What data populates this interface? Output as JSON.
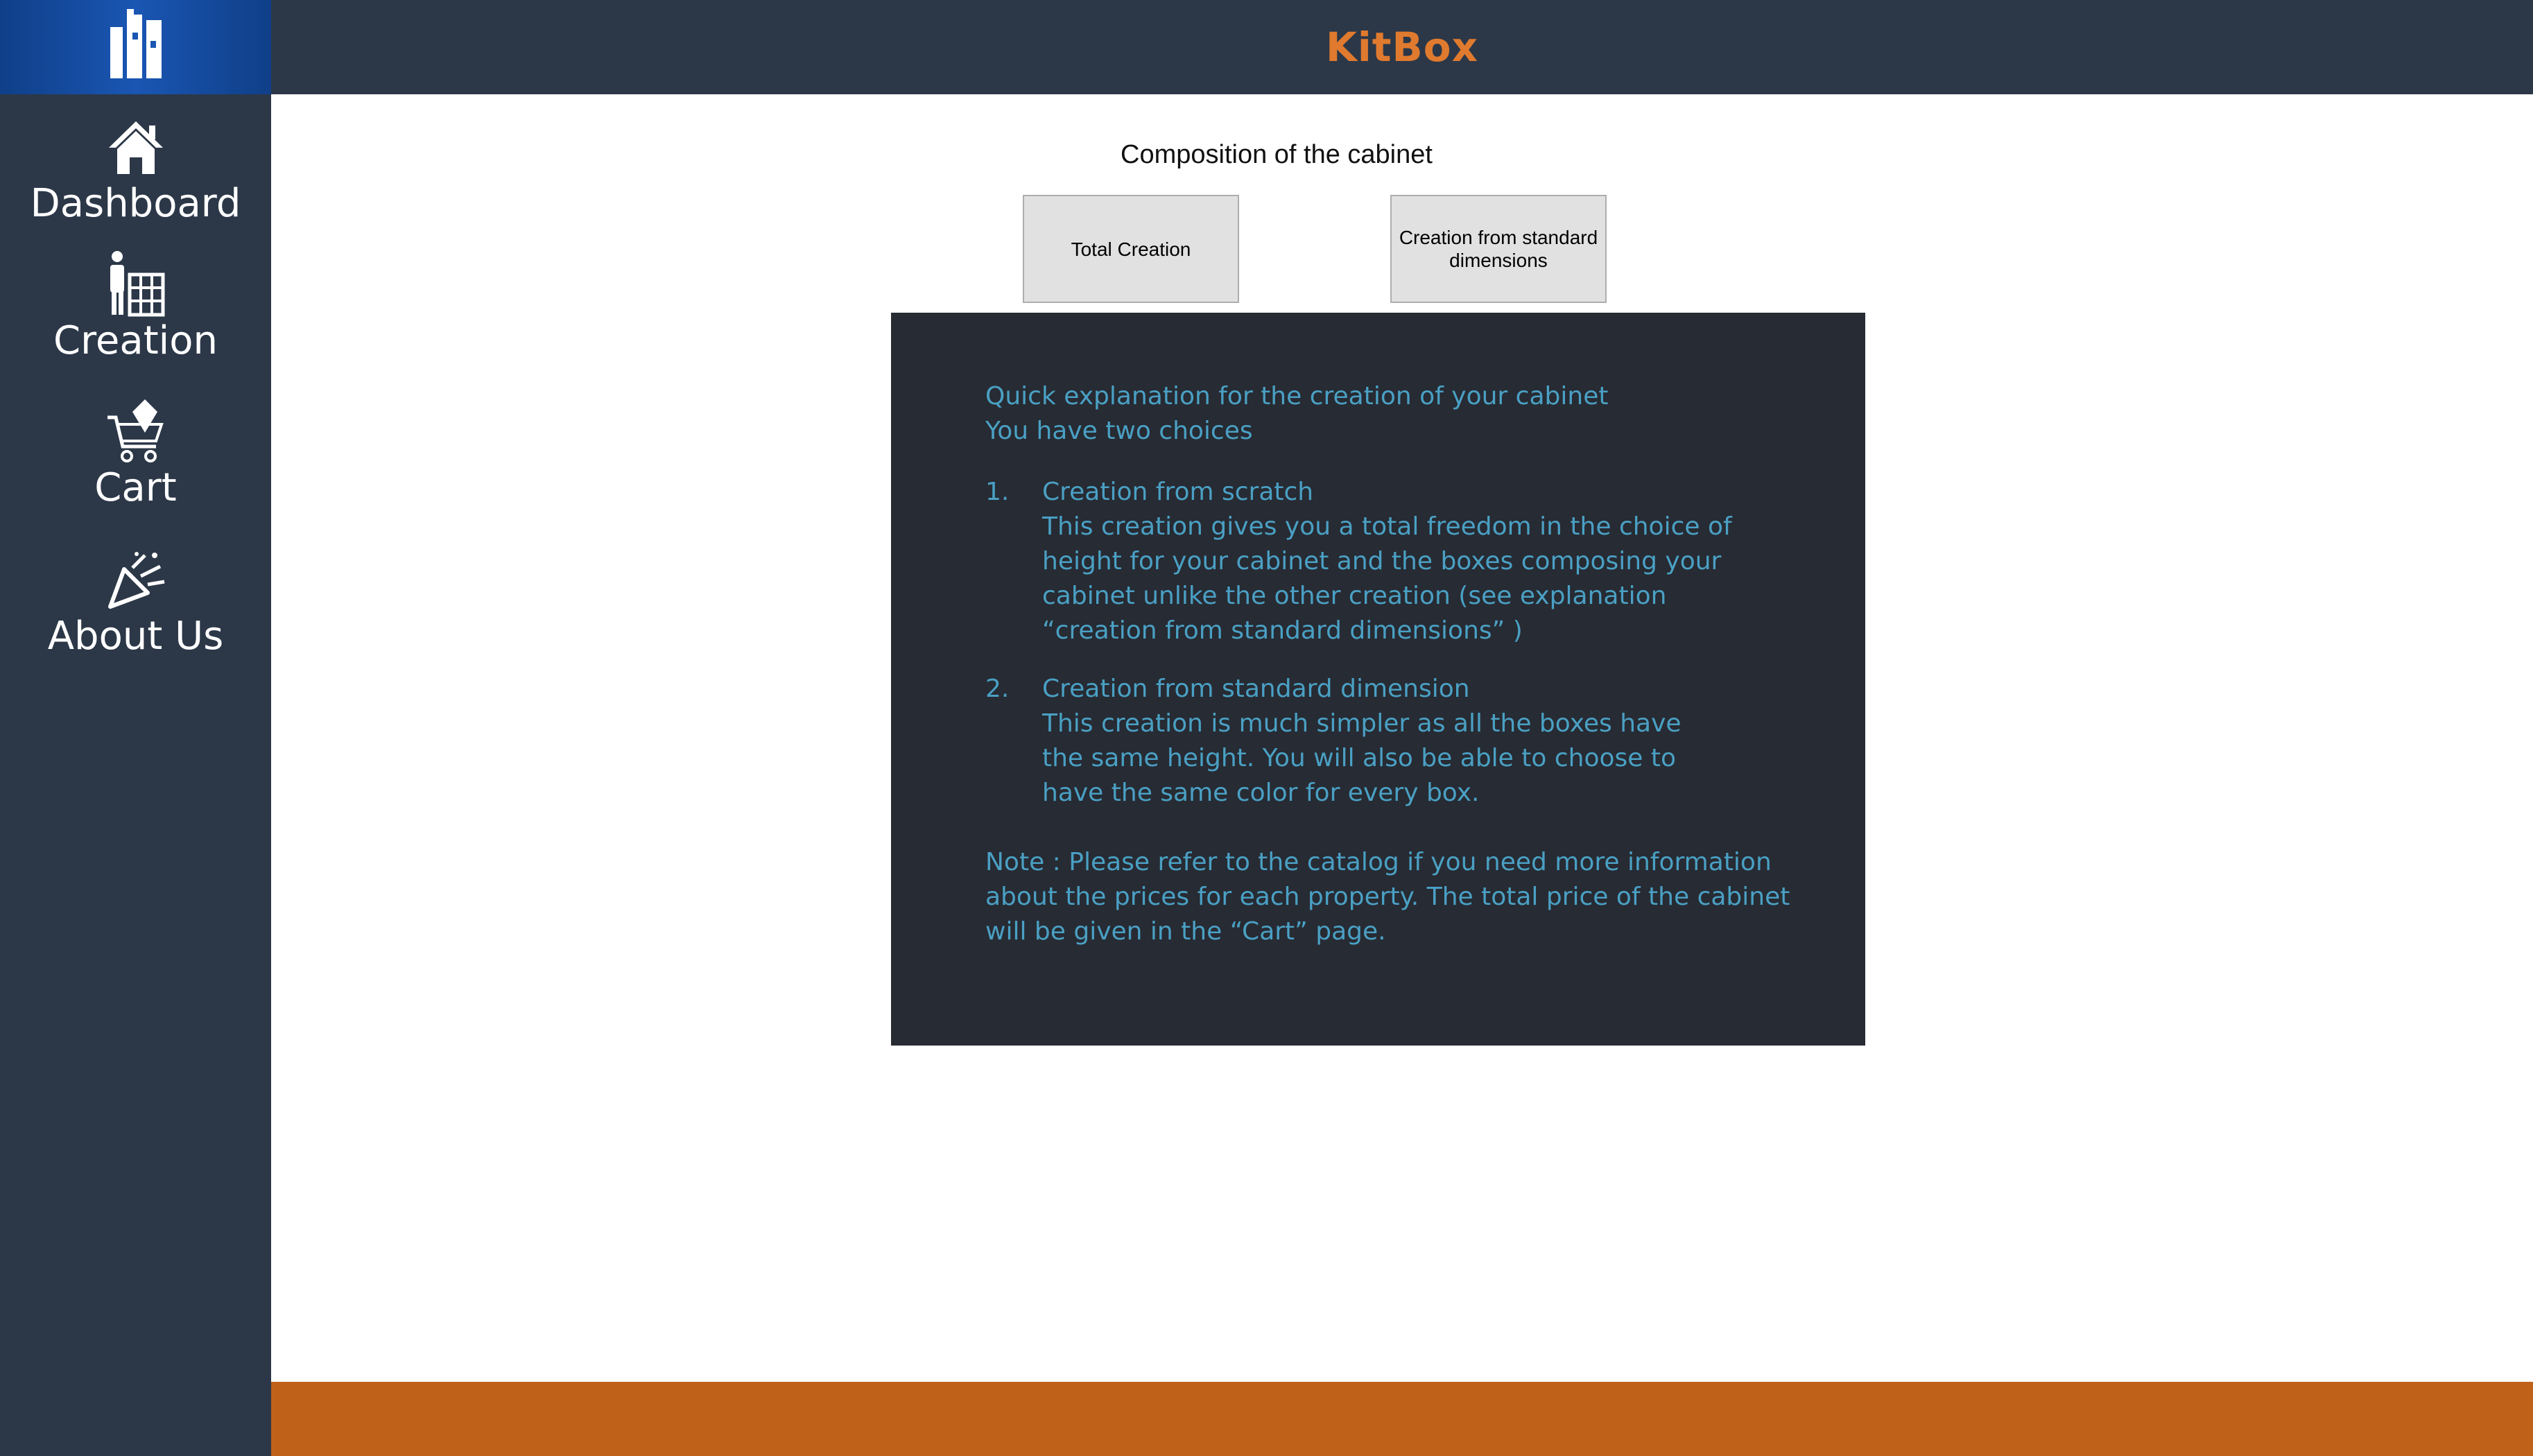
{
  "app": {
    "title": "KitBox",
    "accent_color": "#e07a2e",
    "sidebar_color": "#2c3848",
    "footer_color": "#c0611a"
  },
  "sidebar": {
    "logo_icon": "kitbox-logo-icon",
    "items": [
      {
        "label": "Dashboard",
        "icon": "house-icon"
      },
      {
        "label": "Creation",
        "icon": "person-cabinet-icon"
      },
      {
        "label": "Cart",
        "icon": "shopping-cart-icon"
      },
      {
        "label": "About Us",
        "icon": "party-popper-icon"
      }
    ]
  },
  "main": {
    "title": "Composition of the cabinet",
    "buttons": {
      "total_creation": "Total Creation",
      "standard_creation": "Creation from standard dimensions"
    },
    "explanation": {
      "intro_line1": "Quick explanation for the creation of your cabinet",
      "intro_line2": "You have two choices",
      "item1": {
        "number": "1.",
        "title": "Creation from scratch",
        "lines": [
          "This creation gives you a total freedom in the choice of",
          "height for your cabinet and the boxes composing your",
          "cabinet unlike the other creation (see explanation",
          "“creation from standard dimensions” )"
        ]
      },
      "item2": {
        "number": "2.",
        "title": "Creation from standard dimension",
        "lines": [
          "This creation is much simpler as all the boxes have",
          "the same height. You will also be able to choose to",
          "have the same color for every box."
        ]
      },
      "note_lines": [
        "Note : Please refer to the catalog if you need more information",
        "about the prices for each property. The total price of the cabinet",
        "will be given in the “Cart” page."
      ]
    }
  }
}
